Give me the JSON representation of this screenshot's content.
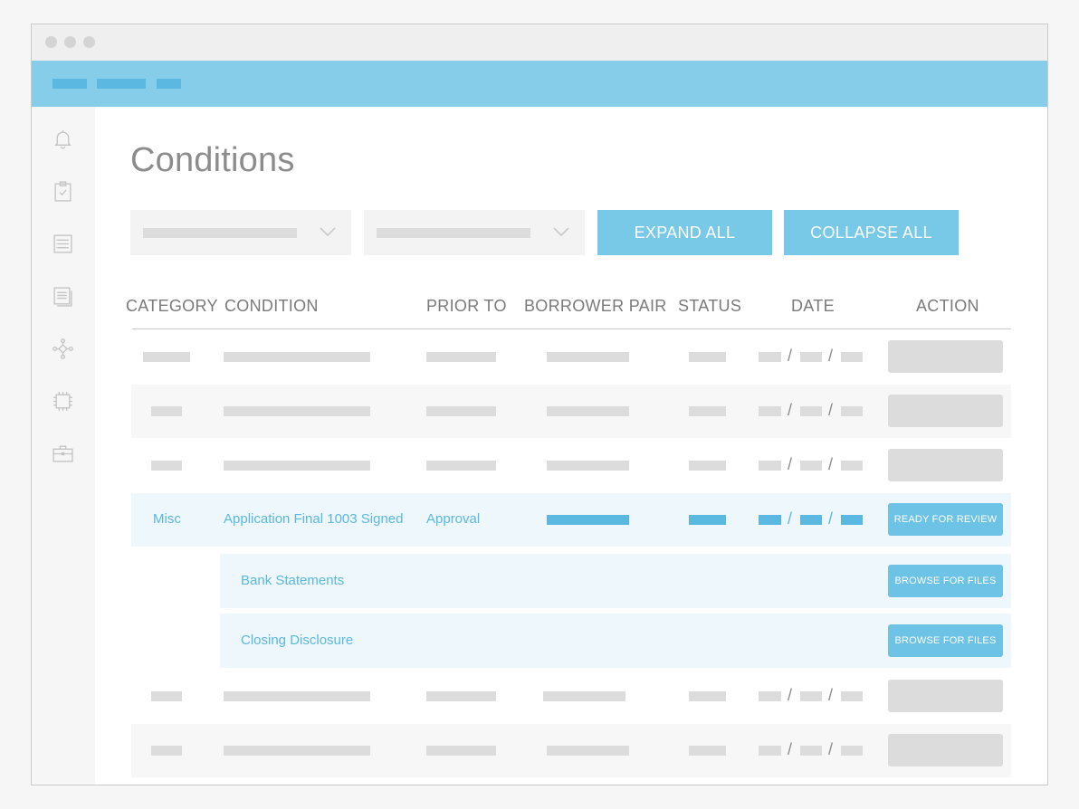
{
  "page": {
    "title": "Conditions"
  },
  "toolbar": {
    "expand_label": "EXPAND ALL",
    "collapse_label": "COLLAPSE ALL"
  },
  "table": {
    "headers": {
      "category": "CATEGORY",
      "condition": "CONDITION",
      "prior_to": "PRIOR TO",
      "borrower_pair": "BORROWER PAIR",
      "status": "STATUS",
      "date": "DATE",
      "action": "ACTION"
    },
    "highlighted_row": {
      "category": "Misc",
      "condition": "Application Final 1003 Signed",
      "prior_to": "Approval",
      "action_label": "READY FOR REVIEW"
    },
    "sub_rows": [
      {
        "label": "Bank Statements",
        "action_label": "BROWSE FOR FILES"
      },
      {
        "label": "Closing Disclosure",
        "action_label": "BROWSE FOR FILES"
      }
    ],
    "date_separator": "/"
  },
  "sidebar": {
    "icons": [
      "bell-icon",
      "clipboard-check-icon",
      "list-document-icon",
      "stacked-documents-icon",
      "network-hub-icon",
      "chip-icon",
      "briefcase-icon"
    ]
  },
  "colors": {
    "accent": "#78c8e8",
    "header_bar": "#86cdea",
    "highlight_text": "#5bb8e0",
    "placeholder": "#dcdcdc"
  }
}
